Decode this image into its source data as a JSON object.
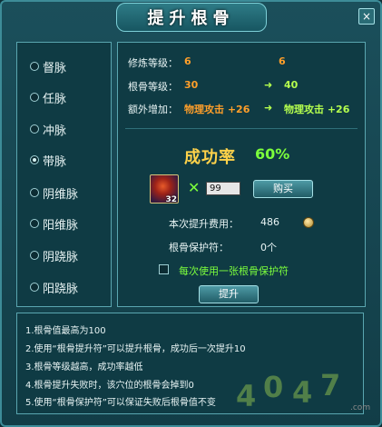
{
  "window": {
    "title": "提升根骨",
    "close_glyph": "×"
  },
  "meridians": [
    {
      "label": "督脉",
      "selected": false
    },
    {
      "label": "任脉",
      "selected": false
    },
    {
      "label": "冲脉",
      "selected": false
    },
    {
      "label": "带脉",
      "selected": true
    },
    {
      "label": "阴维脉",
      "selected": false
    },
    {
      "label": "阳维脉",
      "selected": false
    },
    {
      "label": "阴跷脉",
      "selected": false
    },
    {
      "label": "阳跷脉",
      "selected": false
    }
  ],
  "stats": {
    "cultivation_label": "修炼等级：",
    "cultivation_current": "6",
    "cultivation_next": "6",
    "root_label": "根骨等级：",
    "root_current": "30",
    "root_next": "40",
    "extra_label": "额外增加：",
    "extra_current": "物理攻击 +26",
    "extra_next": "物理攻击 +26",
    "arrow_glyph": "➜"
  },
  "success": {
    "label": "成功率",
    "value": "60%"
  },
  "item": {
    "count": "32",
    "times_glyph": "✕",
    "quantity": "99",
    "buy_label": "购买"
  },
  "cost": {
    "label": "本次提升费用：",
    "value": "486",
    "protect_label": "根骨保护符：",
    "protect_value": "0个"
  },
  "option": {
    "use_protect_label": "每次使用一张根骨保护符",
    "checked": false
  },
  "upgrade_label": "提升",
  "notes": [
    "1.根骨值最高为100",
    "2.使用“根骨提升符”可以提升根骨，成功后一次提升10",
    "3.根骨等级越高，成功率越低",
    "4.根骨提升失败时，该穴位的根骨会掉到0",
    "5.使用“根骨保护符”可以保证失败后根骨值不变"
  ],
  "watermark": {
    "digits": [
      "4",
      "0",
      "4",
      "7"
    ],
    "suffix": ".com"
  },
  "colors": {
    "accent_orange": "#ff9f2a",
    "accent_green": "#7cff3c",
    "gold": "#ffd24a"
  }
}
